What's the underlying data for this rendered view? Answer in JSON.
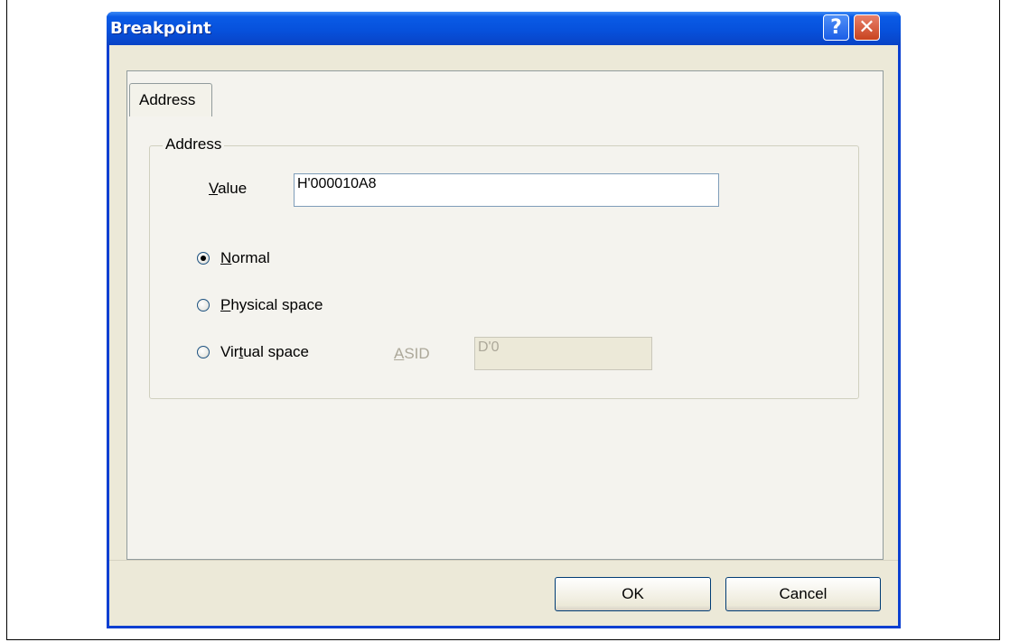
{
  "window": {
    "title": "Breakpoint"
  },
  "title_buttons": {
    "help": "?",
    "close": "✕"
  },
  "tabs": [
    {
      "label": "Address",
      "selected": true
    }
  ],
  "address_group": {
    "legend": "Address",
    "value_label": {
      "mnemonic": "V",
      "rest": "alue"
    },
    "value": "H'000010A8",
    "radios": [
      {
        "mnemonic": "N",
        "rest": "ormal",
        "checked": true
      },
      {
        "mnemonic": "P",
        "rest": "hysical space",
        "checked": false
      },
      {
        "pre": "Vir",
        "mnemonic": "t",
        "rest": "ual space",
        "checked": false
      }
    ],
    "asid_label": {
      "mnemonic": "A",
      "rest": "SID"
    },
    "asid_value": "D'0"
  },
  "buttons": {
    "ok": "OK",
    "cancel": "Cancel"
  },
  "colors": {
    "titlebar": "#0751dc",
    "dialog_bg": "#ece9d8",
    "radio_checked": "#000000"
  }
}
